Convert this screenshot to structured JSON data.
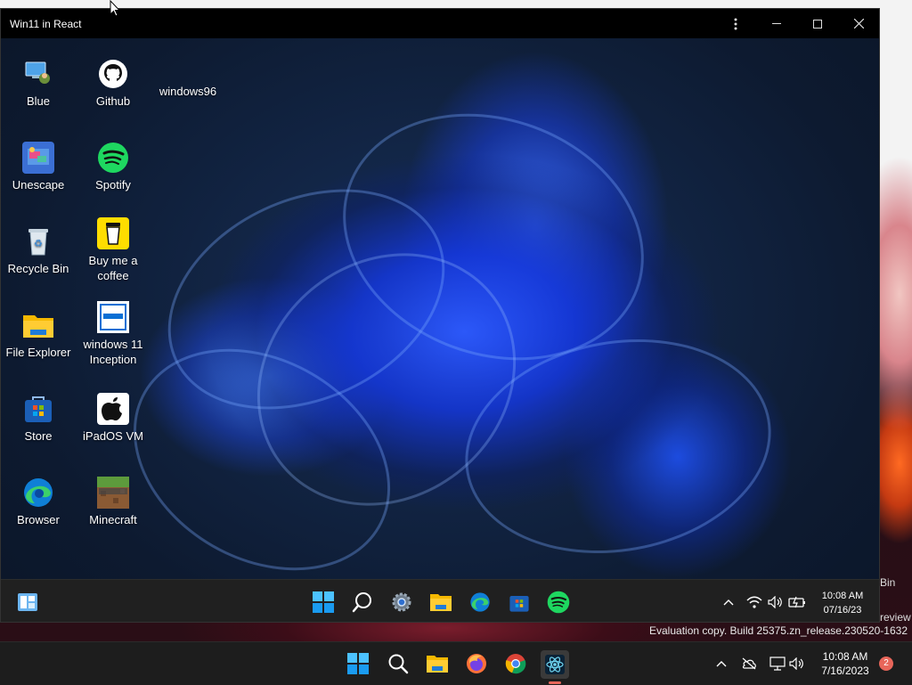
{
  "window": {
    "title": "Win11 in React"
  },
  "desktop_icons": [
    {
      "label": "Blue",
      "icon": "blue-app-icon"
    },
    {
      "label": "Github",
      "icon": "github-icon"
    },
    {
      "label": "windows96",
      "icon": "windows96-icon"
    },
    {
      "label": "Unescape",
      "icon": "unescape-icon"
    },
    {
      "label": "Spotify",
      "icon": "spotify-icon"
    },
    {
      "label": "Recycle Bin",
      "icon": "recycle-bin-icon"
    },
    {
      "label": "Buy me a coffee",
      "icon": "coffee-cup-icon"
    },
    {
      "label": "File Explorer",
      "icon": "folder-icon"
    },
    {
      "label": "windows 11 Inception",
      "icon": "windows11-inception-icon"
    },
    {
      "label": "Store",
      "icon": "store-icon"
    },
    {
      "label": "iPadOS VM",
      "icon": "apple-icon"
    },
    {
      "label": "Browser",
      "icon": "edge-icon"
    },
    {
      "label": "Minecraft",
      "icon": "minecraft-icon"
    }
  ],
  "inner_taskbar": {
    "apps": [
      "start-icon",
      "search-icon",
      "settings-icon",
      "file-explorer-icon",
      "edge-icon",
      "store-icon",
      "spotify-icon"
    ],
    "time": "10:08 AM",
    "date": "07/16/23"
  },
  "host": {
    "recycle_partial": "Bin",
    "preview_partial": "review",
    "watermark": "Evaluation copy. Build 25375.zn_release.230520-1632",
    "taskbar": {
      "apps": [
        "start-icon",
        "search-icon",
        "file-explorer-icon",
        "firefox-icon",
        "chrome-icon",
        "electron-app-icon"
      ],
      "time": "10:08 AM",
      "date": "7/16/2023",
      "notification_count": "2"
    }
  },
  "colors": {
    "accent_blue": "#1e5bff",
    "taskbar_bg": "#202020",
    "titlebar_bg": "#000000",
    "badge": "#e8665a"
  }
}
